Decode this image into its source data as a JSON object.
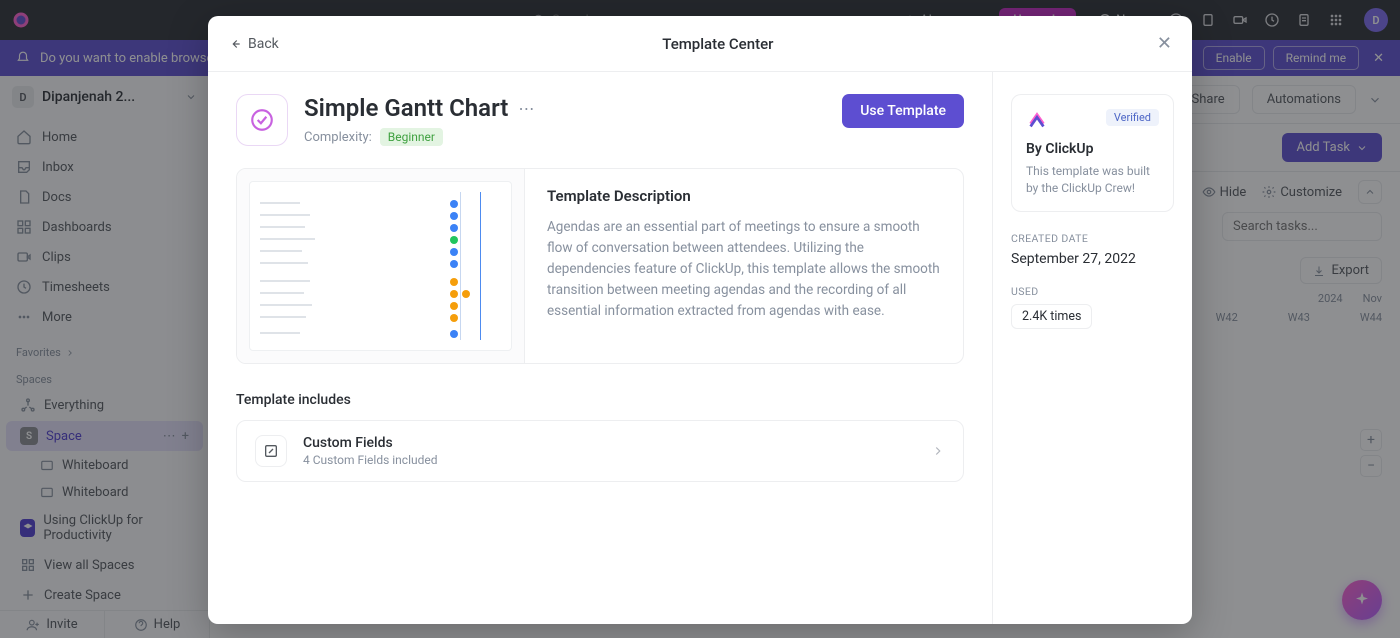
{
  "topbar": {
    "search_placeholder": "Search",
    "ai_label": "AI",
    "upgrade_label": "Upgrade",
    "new_label": "New",
    "avatar_initial": "D"
  },
  "banner": {
    "text": "Do you want to enable browser",
    "enable_label": "Enable",
    "remind_label": "Remind me"
  },
  "workspace": {
    "initial": "D",
    "name": "Dipanjenah 2..."
  },
  "sidebar": {
    "nav": [
      {
        "label": "Home"
      },
      {
        "label": "Inbox"
      },
      {
        "label": "Docs"
      },
      {
        "label": "Dashboards"
      },
      {
        "label": "Clips"
      },
      {
        "label": "Timesheets"
      },
      {
        "label": "More"
      }
    ],
    "favorites_label": "Favorites",
    "spaces_label": "Spaces",
    "spaces": [
      {
        "label": "Everything"
      },
      {
        "label": "Space",
        "initial": "S",
        "active": true
      },
      {
        "label": "Whiteboard",
        "sub": true
      },
      {
        "label": "Whiteboard",
        "sub": true
      },
      {
        "label": "Using ClickUp for Productivity"
      },
      {
        "label": "View all Spaces"
      },
      {
        "label": "Create Space"
      }
    ],
    "invite_label": "Invite",
    "help_label": "Help"
  },
  "main": {
    "share_label": "Share",
    "automations_label": "Automations",
    "add_task_label": "Add Task",
    "hide_label": "Hide",
    "customize_label": "Customize",
    "search_tasks_placeholder": "Search tasks...",
    "export_label": "Export",
    "timeline_year": "2024",
    "timeline_month": "Nov",
    "timeline_weeks": [
      "W42",
      "W43",
      "W44"
    ]
  },
  "modal": {
    "back_label": "Back",
    "title": "Template Center",
    "template_name": "Simple Gantt Chart",
    "complexity_label": "Complexity:",
    "complexity_value": "Beginner",
    "use_button": "Use Template",
    "description_heading": "Template Description",
    "description_text": "Agendas are an essential part of meetings to ensure a smooth flow of conversation between attendees. Utilizing the dependencies feature of ClickUp, this template allows the smooth transition between meeting agendas and the recording of all essential information extracted from agendas with ease.",
    "includes_heading": "Template includes",
    "includes": [
      {
        "title": "Custom Fields",
        "subtitle": "4 Custom Fields included"
      }
    ],
    "side": {
      "verified_label": "Verified",
      "by_label": "By ClickUp",
      "by_blurb": "This template was built by the ClickUp Crew!",
      "created_label": "CREATED DATE",
      "created_value": "September 27, 2022",
      "used_label": "USED",
      "used_value": "2.4K times"
    }
  }
}
